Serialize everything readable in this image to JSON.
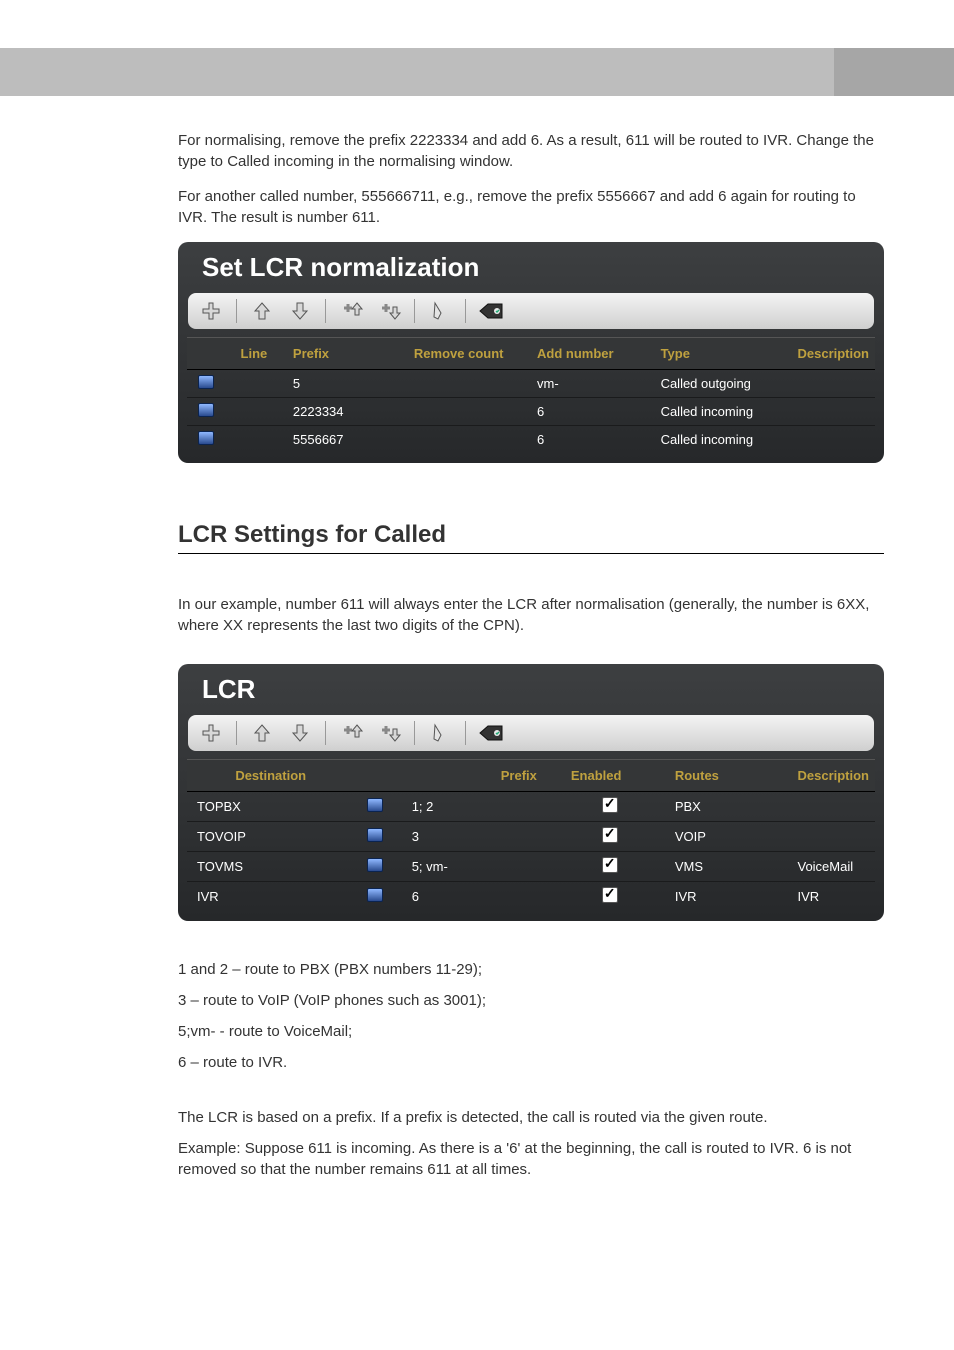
{
  "intro": {
    "p1": "For normalising, remove the prefix 2223334 and add 6. As a result, 611 will be routed to IVR. Change the type to Called incoming in the normalising window.",
    "p2": "For another called number, 555666711, e.g., remove the prefix 5556667 and add 6 again for routing to IVR. The result is number 611."
  },
  "normPanel": {
    "title": "Set LCR normalization",
    "headers": [
      "",
      "Line",
      "Prefix",
      "Remove count",
      "Add number",
      "Type",
      "Description"
    ],
    "rows": [
      {
        "line": "",
        "prefix": "5",
        "remove": "",
        "add": "vm-",
        "type": "Called outgoing",
        "desc": ""
      },
      {
        "line": "",
        "prefix": "2223334",
        "remove": "",
        "add": "6",
        "type": "Called incoming",
        "desc": ""
      },
      {
        "line": "",
        "prefix": "5556667",
        "remove": "",
        "add": "6",
        "type": "Called incoming",
        "desc": ""
      }
    ]
  },
  "sectionTitle": "LCR Settings for Called",
  "sectionIntro": "In our example, number 611 will always enter the LCR after normalisation (generally, the number is 6XX, where XX represents the last two digits of the CPN).",
  "lcrPanel": {
    "title": "LCR",
    "headers": [
      "Destination",
      "",
      "Prefix",
      "Enabled",
      "Routes",
      "Description"
    ],
    "rows": [
      {
        "dest": "TOPBX",
        "prefix": "1; 2",
        "enabled": true,
        "routes": "PBX",
        "desc": ""
      },
      {
        "dest": "TOVOIP",
        "prefix": "3",
        "enabled": true,
        "routes": "VOIP",
        "desc": ""
      },
      {
        "dest": "TOVMS",
        "prefix": "5; vm-",
        "enabled": true,
        "routes": "VMS",
        "desc": "VoiceMail"
      },
      {
        "dest": "IVR",
        "prefix": "6",
        "enabled": true,
        "routes": "IVR",
        "desc": "IVR"
      }
    ]
  },
  "notes": {
    "n1": "1 and 2 – route to PBX (PBX numbers 11-29);",
    "n2": "3 – route to VoIP (VoIP phones such as 3001);",
    "n3": "5;vm- - route to VoiceMail;",
    "n4": "6 – route to IVR.",
    "p5": "The LCR is based on a prefix. If a prefix is detected, the call is routed via the given route.",
    "p6": "Example: Suppose 611 is incoming. As there is a '6' at the beginning, the call is routed to IVR. 6 is not removed so that the number remains 611 at all times."
  }
}
